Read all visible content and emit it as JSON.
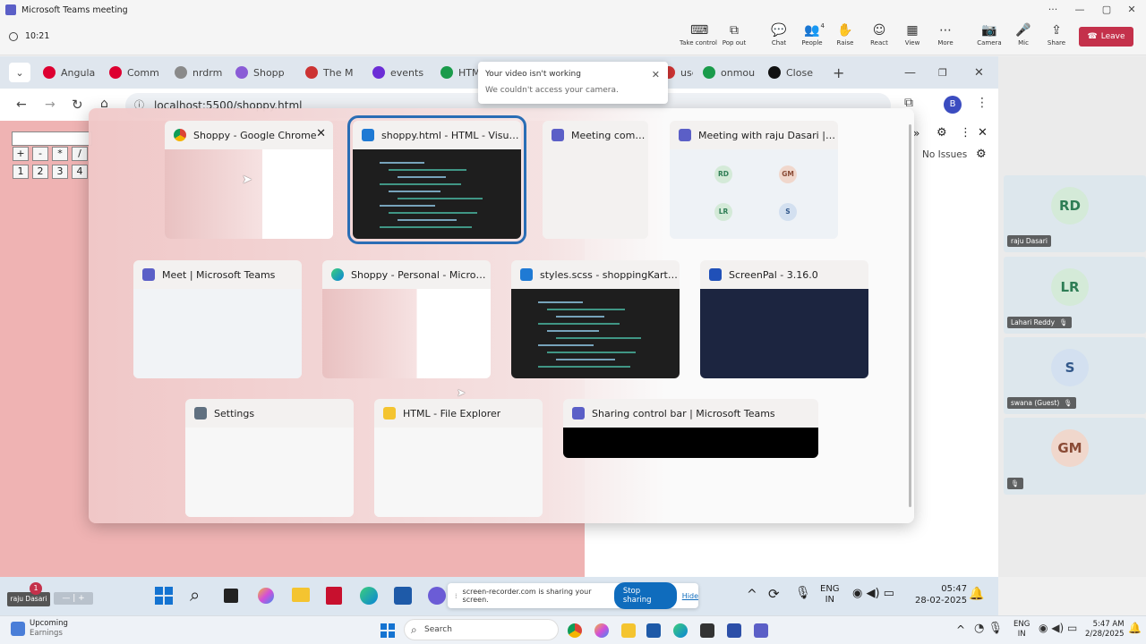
{
  "teams": {
    "window_title": "Microsoft Teams meeting",
    "timer": "10:21",
    "toolbar": [
      {
        "name": "take-control",
        "label": "Take control"
      },
      {
        "name": "pop-out",
        "label": "Pop out"
      },
      {
        "name": "chat",
        "label": "Chat"
      },
      {
        "name": "people",
        "label": "People",
        "badge": "4"
      },
      {
        "name": "raise",
        "label": "Raise"
      },
      {
        "name": "react",
        "label": "React"
      },
      {
        "name": "view",
        "label": "View"
      },
      {
        "name": "more",
        "label": "More"
      },
      {
        "name": "camera",
        "label": "Camera"
      },
      {
        "name": "mic",
        "label": "Mic"
      },
      {
        "name": "share",
        "label": "Share"
      }
    ],
    "leave_label": "Leave",
    "toast": {
      "title": "Your video isn't working",
      "message": "We couldn't access your camera."
    },
    "participants": [
      {
        "initials": "RD",
        "name": "raju Dasari",
        "color": "#2e7d55",
        "bg": "#d4ead8",
        "muted": false
      },
      {
        "initials": "LR",
        "name": "Lahari Reddy",
        "color": "#2e7d55",
        "bg": "#d4ead8",
        "muted": true
      },
      {
        "initials": "S",
        "name": "swana (Guest)",
        "color": "#31578a",
        "bg": "#d3e0f0",
        "muted": true
      },
      {
        "initials": "GM",
        "name": "",
        "color": "#8a4b36",
        "bg": "#f0d7cc",
        "muted": true
      }
    ]
  },
  "chrome": {
    "tabs": [
      "Angula",
      "Comm",
      "nrdrm",
      "Shopp",
      "The M",
      "events",
      "HTM",
      "use",
      "onmou",
      "Close"
    ],
    "url": "localhost:5500/shoppy.html",
    "profile_initial": "B",
    "devtools_label": "No Issues"
  },
  "calculator": {
    "ops": [
      "+",
      "-",
      "*",
      "/"
    ],
    "digits": [
      "1",
      "2",
      "3",
      "4"
    ]
  },
  "switcher": {
    "windows": [
      {
        "title": "Shoppy - Google Chrome",
        "icon": "chrome-icon"
      },
      {
        "title": "shoppy.html - HTML - Visual...",
        "icon": "vscode-icon",
        "selected": true
      },
      {
        "title": "Meeting comp...",
        "icon": "teams-icon"
      },
      {
        "title": "Meeting with raju Dasari | Mic...",
        "icon": "teams-icon"
      },
      {
        "title": "Meet | Microsoft Teams",
        "icon": "teams-icon"
      },
      {
        "title": "Shoppy - Personal - Microsoft...",
        "icon": "edge-icon"
      },
      {
        "title": "styles.scss - shoppingKart - Vi...",
        "icon": "vscode-icon"
      },
      {
        "title": "ScreenPal - 3.16.0",
        "icon": "screenpal-icon"
      },
      {
        "title": "Settings",
        "icon": "settings-icon"
      },
      {
        "title": "HTML - File Explorer",
        "icon": "folder-icon"
      },
      {
        "title": "Sharing control bar | Microsoft Teams",
        "icon": "teams-icon"
      }
    ],
    "mini_avatars": [
      "RD",
      "GM",
      "LR",
      "S"
    ]
  },
  "inner_taskbar": {
    "self_name": "raju Dasari",
    "notification_count": "1",
    "sharing_text": "screen-recorder.com is sharing your screen.",
    "stop_label": "Stop sharing",
    "hide_label": "Hide",
    "lang": "ENG",
    "lang2": "IN",
    "time": "05:47",
    "date": "28-02-2025"
  },
  "outer_taskbar": {
    "upcoming_title": "Upcoming",
    "upcoming_sub": "Earnings",
    "search_placeholder": "Search",
    "lang": "ENG",
    "lang2": "IN",
    "time": "5:47 AM",
    "date": "2/28/2025"
  }
}
